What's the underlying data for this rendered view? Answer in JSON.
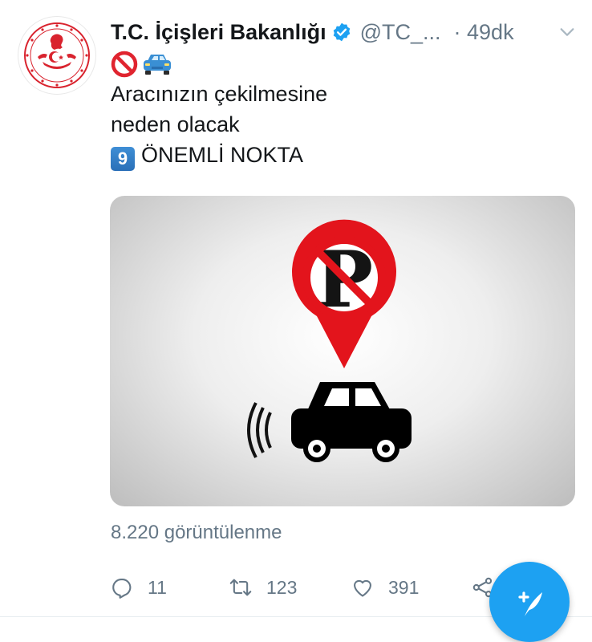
{
  "tweet": {
    "author_name": "T.C. İçişleri Bakanlığı",
    "handle": "@TC_...",
    "time": "· 49dk",
    "lines": [
      "Aracınızın çekilmesine",
      "neden olacak"
    ],
    "keycap_number": "9",
    "points_text": "ÖNEMLİ NOKTA",
    "views": "8.220 görüntülenme"
  },
  "actions": {
    "replies": "11",
    "retweets": "123",
    "likes": "391"
  },
  "icons": {
    "verified": "verified-badge-icon",
    "chevron": "chevron-down-icon",
    "no_entry": "no-entry-emoji-icon",
    "car": "car-emoji-icon",
    "reply": "reply-icon",
    "retweet": "retweet-icon",
    "like": "heart-icon",
    "share": "share-icon",
    "compose": "compose-tweet-icon"
  },
  "colors": {
    "accent": "#1da1f2",
    "secondary_text": "#657786",
    "seal_red": "#d9232e"
  }
}
